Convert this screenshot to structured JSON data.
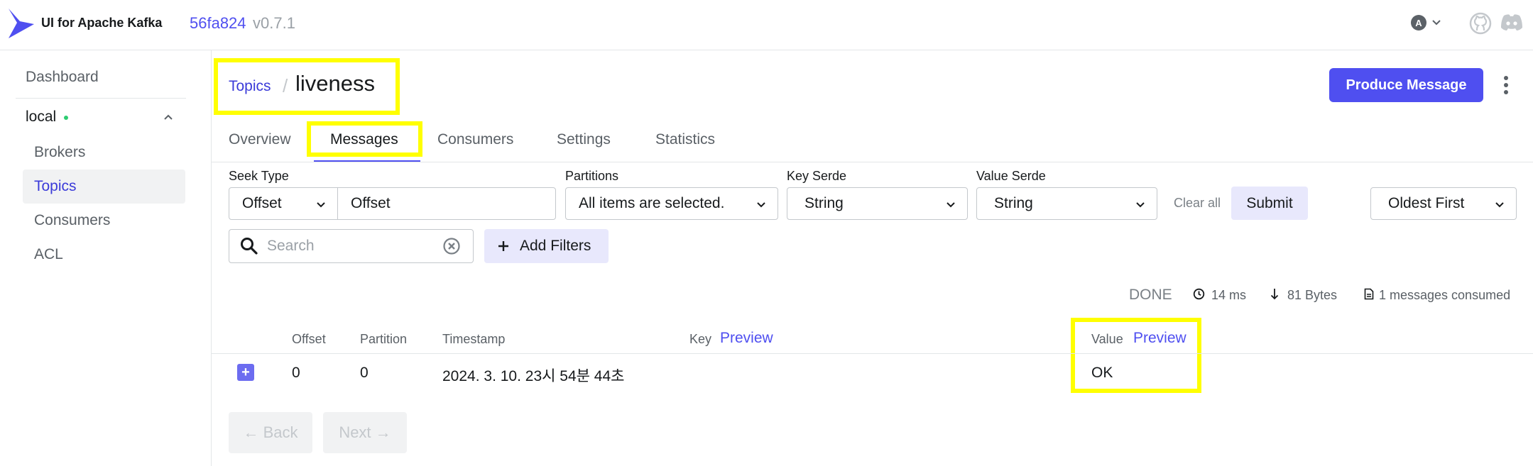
{
  "header": {
    "app_name": "UI for Apache Kafka",
    "commit": "56fa824",
    "version": "v0.7.1",
    "avatar_letter": "A"
  },
  "sidebar": {
    "dashboard": "Dashboard",
    "cluster": "local",
    "items": [
      {
        "label": "Brokers",
        "active": false
      },
      {
        "label": "Topics",
        "active": true
      },
      {
        "label": "Consumers",
        "active": false
      },
      {
        "label": "ACL",
        "active": false
      }
    ]
  },
  "breadcrumb": {
    "parent": "Topics",
    "separator": "/",
    "current": "liveness"
  },
  "produce_button": "Produce Message",
  "tabs": [
    "Overview",
    "Messages",
    "Consumers",
    "Settings",
    "Statistics"
  ],
  "filters": {
    "seek_type_label": "Seek Type",
    "seek_type_value": "Offset",
    "offset_placeholder": "Offset",
    "partitions_label": "Partitions",
    "partitions_value": "All items are selected.",
    "key_serde_label": "Key Serde",
    "key_serde_value": "String",
    "value_serde_label": "Value Serde",
    "value_serde_value": "String",
    "clear_all": "Clear all",
    "submit": "Submit",
    "sort": "Oldest First",
    "search_placeholder": "Search",
    "add_filters": "Add Filters"
  },
  "stats": {
    "status": "DONE",
    "elapsed": "14 ms",
    "bytes": "81 Bytes",
    "consumed": "1 messages consumed"
  },
  "table": {
    "headers": {
      "offset": "Offset",
      "partition": "Partition",
      "timestamp": "Timestamp",
      "key": "Key",
      "key_preview": "Preview",
      "value": "Value",
      "value_preview": "Preview"
    },
    "rows": [
      {
        "offset": "0",
        "partition": "0",
        "timestamp": "2024. 3. 10. 23시 54분 44초",
        "key": "",
        "value": "OK"
      }
    ]
  },
  "pagination": {
    "back": "← Back",
    "next": "Next →"
  },
  "colors": {
    "accent": "#4f4ff0",
    "highlight": "#ffff00"
  }
}
